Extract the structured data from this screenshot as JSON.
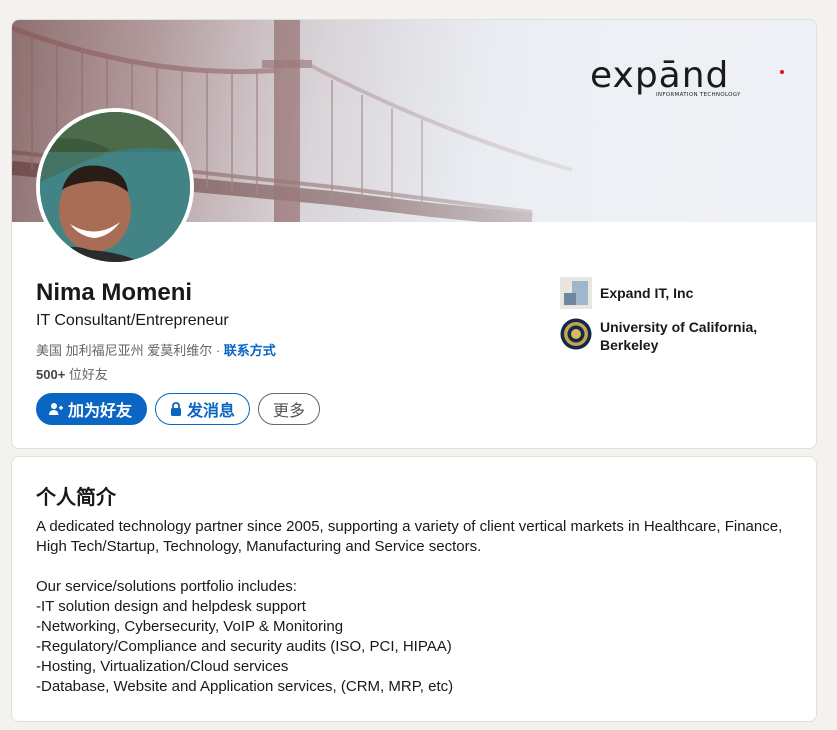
{
  "profile": {
    "name": "Nima Momeni",
    "headline": "IT Consultant/Entrepreneur",
    "location": "美国 加利福尼亚州 爱莫利维尔 · ",
    "contact_link": "联系方式",
    "connections_count": "500+",
    "connections_suffix": " 位好友"
  },
  "banner": {
    "brand_word": "expānd",
    "brand_sub": "INFORMATION TECHNOLOGY"
  },
  "actions": {
    "connect_label": "加为好友",
    "message_label": "发消息",
    "more_label": "更多"
  },
  "orgs": {
    "company": "Expand IT, Inc",
    "school": "University of California, Berkeley"
  },
  "about": {
    "title": "个人简介",
    "body": "A dedicated technology partner since 2005, supporting a variety of client vertical markets in Healthcare, Finance, High Tech/Startup, Technology, Manufacturing and Service sectors.\n\nOur service/solutions portfolio includes:\n-IT solution design and helpdesk support\n-Networking, Cybersecurity, VoIP & Monitoring\n-Regulatory/Compliance and security audits (ISO, PCI, HIPAA)\n-Hosting, Virtualization/Cloud services\n-Database, Website and Application services, (CRM, MRP, etc)"
  },
  "colors": {
    "primary": "#0a66c2",
    "background": "#f3f2ef"
  },
  "icons": [
    "add-user-icon",
    "lock-icon"
  ]
}
